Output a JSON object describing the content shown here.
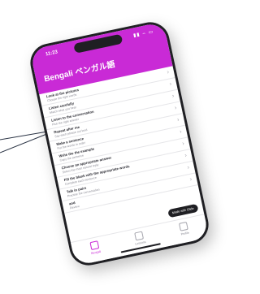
{
  "status": {
    "time": "11:23",
    "icons": "▮▮ ⌢ ▭"
  },
  "app": {
    "title": "Bengali ベンガル語"
  },
  "list": [
    {
      "title": "Look at the pictures",
      "sub": "Choose the right words"
    },
    {
      "title": "Listen carefully",
      "sub": "Match what you hear"
    },
    {
      "title": "Listen to the conversation",
      "sub": "Pick the right answer"
    },
    {
      "title": "Repeat after me",
      "sub": "Say each phrase out loud"
    },
    {
      "title": "Make a sentence",
      "sub": "Put the words in order"
    },
    {
      "title": "Write the the example",
      "sub": "Copy the sentence"
    },
    {
      "title": "Choose an appropriate answer",
      "sub": "Select the most natural reply"
    },
    {
      "title": "Fill the blank with the appropriate words",
      "sub": "Complete each sentence"
    },
    {
      "title": "Talk in pairs",
      "sub": "Practise the conversation"
    },
    {
      "title": "and",
      "sub": "Review"
    }
  ],
  "toast": {
    "text": "Made with Glide"
  },
  "tabs": [
    {
      "label": "Bengali"
    },
    {
      "label": "Lessons"
    },
    {
      "label": "Profile"
    }
  ]
}
